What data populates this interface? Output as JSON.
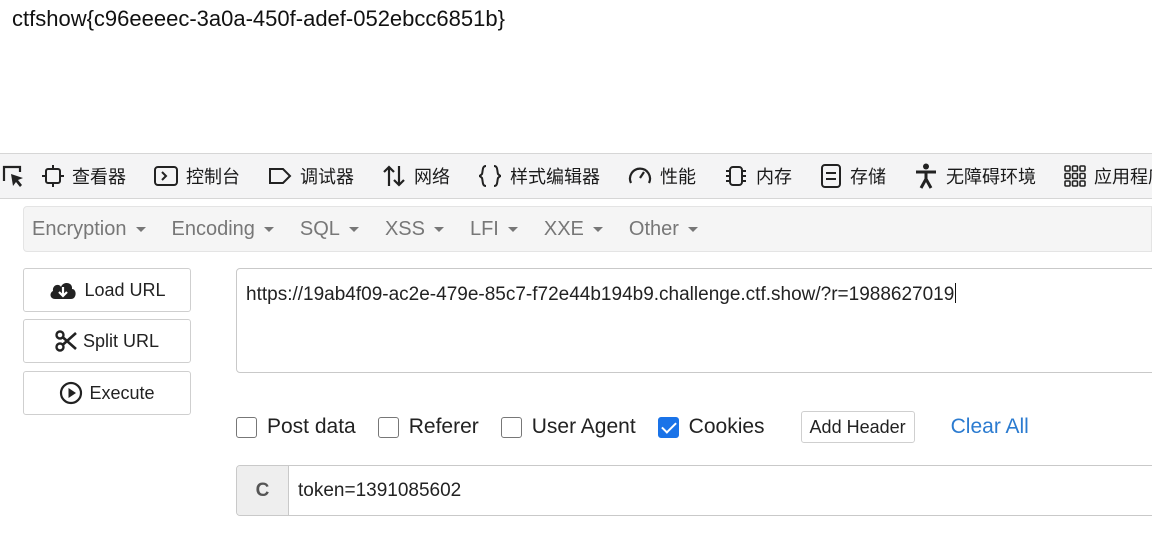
{
  "page": {
    "flag_text": "ctfshow{c96eeeec-3a0a-450f-adef-052ebcc6851b}"
  },
  "devtools": {
    "tabs": [
      {
        "label": "查看器",
        "icon": "inspector-icon"
      },
      {
        "label": "控制台",
        "icon": "console-icon"
      },
      {
        "label": "调试器",
        "icon": "debugger-icon"
      },
      {
        "label": "网络",
        "icon": "network-icon"
      },
      {
        "label": "样式编辑器",
        "icon": "style-editor-icon"
      },
      {
        "label": "性能",
        "icon": "performance-icon"
      },
      {
        "label": "内存",
        "icon": "memory-icon"
      },
      {
        "label": "存储",
        "icon": "storage-icon"
      },
      {
        "label": "无障碍环境",
        "icon": "accessibility-icon"
      },
      {
        "label": "应用程序",
        "icon": "application-icon"
      }
    ]
  },
  "hackbar": {
    "menus": [
      "Encryption",
      "Encoding",
      "SQL",
      "XSS",
      "LFI",
      "XXE",
      "Other"
    ],
    "buttons": {
      "load": "Load URL",
      "split": "Split URL",
      "execute": "Execute"
    },
    "url": "https://19ab4f09-ac2e-479e-85c7-f72e44b194b9.challenge.ctf.show/?r=1988627019",
    "options": {
      "post_data": "Post data",
      "referer": "Referer",
      "user_agent": "User Agent",
      "cookies": "Cookies",
      "add_header": "Add Header",
      "clear_all": "Clear All"
    },
    "cookie": {
      "label": "C",
      "value": "token=1391085602"
    }
  },
  "colors": {
    "accent": "#1a73e8",
    "link": "#2b7bd0",
    "menu_text": "#777777"
  }
}
